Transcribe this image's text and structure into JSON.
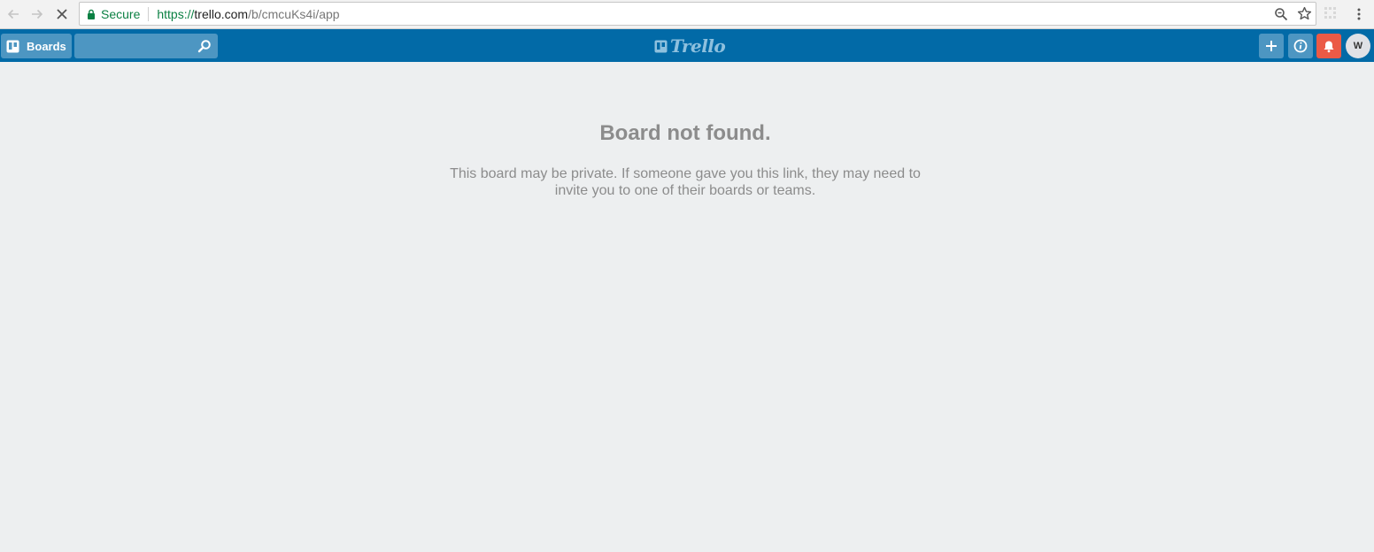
{
  "browser": {
    "secure_label": "Secure",
    "url_scheme": "https://",
    "url_host": "trello.com",
    "url_path": "/b/cmcuKs4i/app",
    "icons": {
      "back": "arrow-left-icon",
      "forward": "arrow-right-icon",
      "stop": "close-icon",
      "lock": "lock-icon",
      "zoom": "zoom-icon",
      "bookmark": "star-icon",
      "extension": "extension-icon",
      "menu": "kebab-menu-icon"
    }
  },
  "header": {
    "boards_label": "Boards",
    "search_value": "",
    "logo_text": "Trello",
    "avatar_initial": "W",
    "colors": {
      "bar": "#026aa7",
      "button": "#4d96c2",
      "notification": "#eb5a46"
    }
  },
  "main": {
    "title": "Board not found.",
    "message": "This board may be private. If someone gave you this link, they may need to invite you to one of their boards or teams."
  }
}
